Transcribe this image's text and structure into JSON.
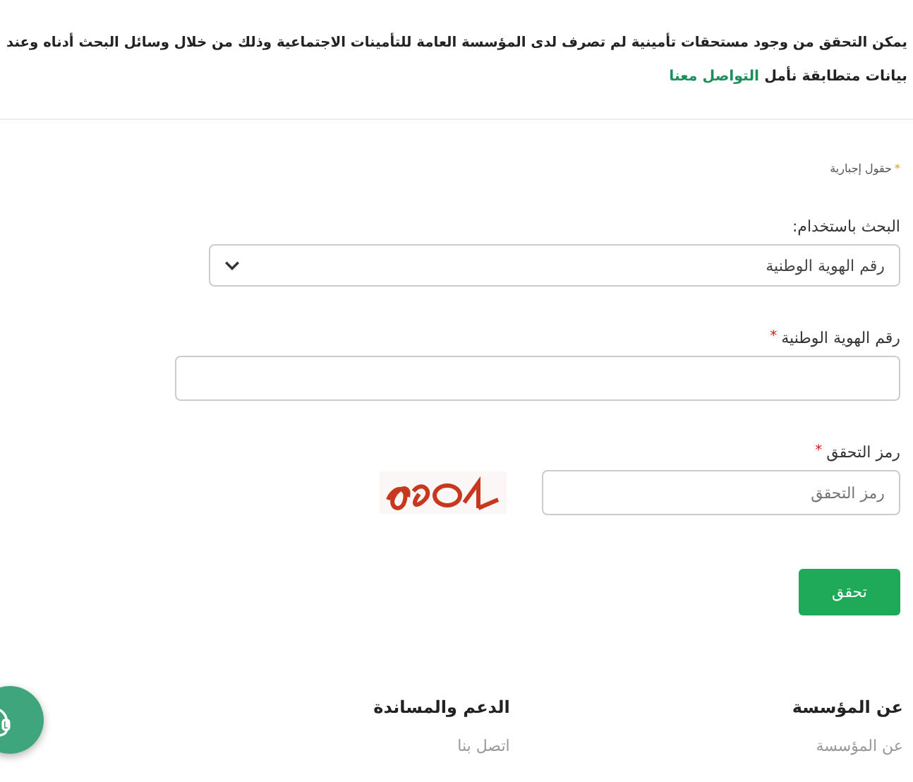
{
  "intro": {
    "line_1": "يمكن التحقق من وجود مستحقات تأمينية لم تصرف لدى المؤسسة العامة للتأمينات الاجتماعية وذلك من خلال وسائل البحث أدناه وعند",
    "line_2": "بيانات متطابقة نأمل",
    "link": "التواصل معنا"
  },
  "form": {
    "required_mark": "*",
    "required_note": "حقول إجبارية",
    "search_by": {
      "label": "البحث باستخدام:",
      "value": "رقم الهوية الوطنية"
    },
    "national_id": {
      "label": "رقم الهوية الوطنية",
      "required_mark": "*"
    },
    "captcha": {
      "label": "رمز التحقق",
      "required_mark": "*",
      "placeholder": "رمز التحقق"
    },
    "submit": "تحقق"
  },
  "footer": {
    "columns": [
      {
        "title": "عن المؤسسة",
        "links": [
          "عن المؤسسة"
        ]
      },
      {
        "title": "الدعم والمساندة",
        "links": [
          "اتصل بنا"
        ]
      }
    ]
  }
}
